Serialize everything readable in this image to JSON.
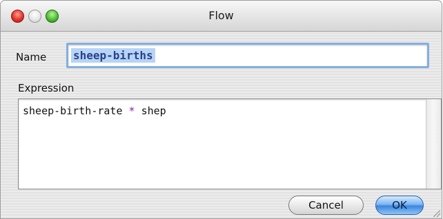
{
  "window": {
    "title": "Flow",
    "controls": [
      "close",
      "minimize",
      "zoom"
    ]
  },
  "form": {
    "name_label": "Name",
    "name_value": "sheep-births",
    "expression_label": "Expression",
    "expression": {
      "lhs": "sheep-birth-rate ",
      "operator": "*",
      "rhs": " shep"
    }
  },
  "buttons": {
    "cancel": "Cancel",
    "ok": "OK"
  },
  "colors": {
    "focus_ring": "#84aee0",
    "selection": "#b6d4f6",
    "operator": "#8a1ca8",
    "default_button": "#3b86df"
  }
}
